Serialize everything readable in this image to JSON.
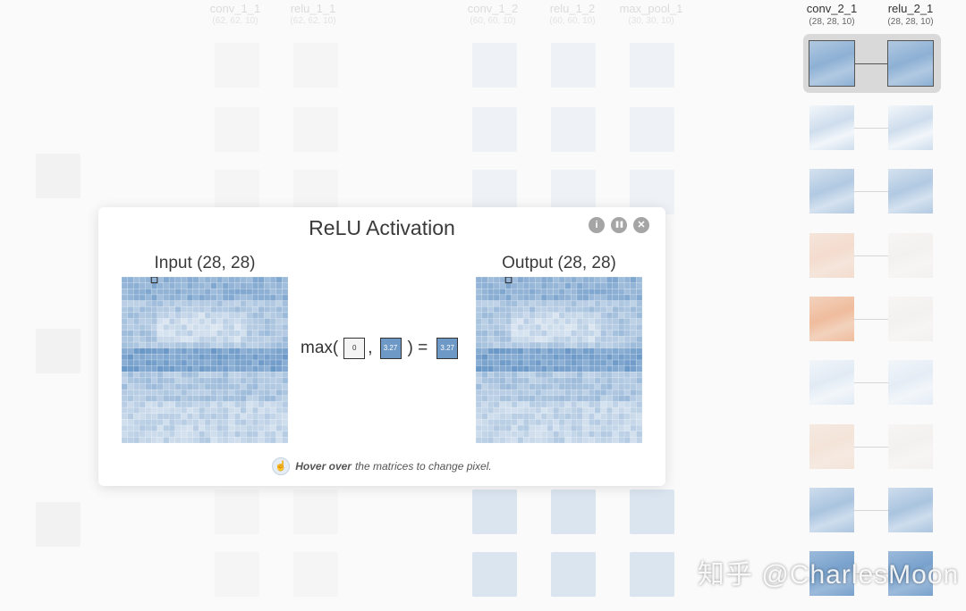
{
  "background_headers": [
    {
      "name": "conv_1_1",
      "dims": "(62, 62, 10)"
    },
    {
      "name": "relu_1_1",
      "dims": "(62, 62, 10)"
    },
    {
      "name": "conv_1_2",
      "dims": "(60, 60, 10)"
    },
    {
      "name": "relu_1_2",
      "dims": "(60, 60, 10)"
    },
    {
      "name": "max_pool_1",
      "dims": "(30, 30, 10)"
    }
  ],
  "layers": [
    {
      "name": "conv_2_1",
      "dims": "(28, 28, 10)"
    },
    {
      "name": "relu_2_1",
      "dims": "(28, 28, 10)"
    }
  ],
  "modal": {
    "title": "ReLU Activation",
    "input_label": "Input (28, 28)",
    "output_label": "Output (28, 28)",
    "formula": {
      "prefix": "max(",
      "zero": "0",
      "comma": ",",
      "input_value": "3.27",
      "close": ") =",
      "output_value": "3.27"
    },
    "hint_bold": "Hover over",
    "hint_rest": "the matrices to change pixel.",
    "controls": {
      "info": "i",
      "pause": "❚❚",
      "close": "✕"
    }
  },
  "watermark": "知乎 @CharlesMoon",
  "colors": {
    "accent": "#6e99c7",
    "negative": "#f0b08c",
    "neutral": "#f4f4f4"
  }
}
